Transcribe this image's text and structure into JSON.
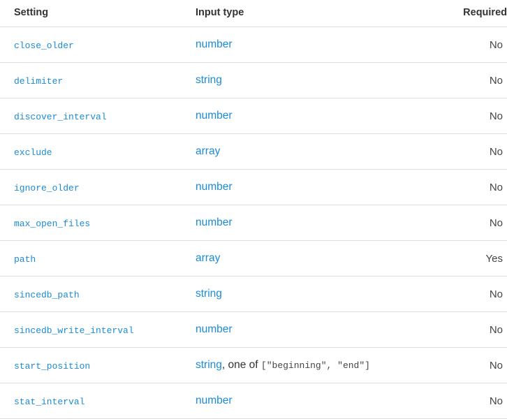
{
  "headers": {
    "setting": "Setting",
    "input_type": "Input type",
    "required": "Required"
  },
  "rows": [
    {
      "setting": "close_older",
      "type_link": "number",
      "type_extra": "",
      "type_code": "",
      "required": "No"
    },
    {
      "setting": "delimiter",
      "type_link": "string",
      "type_extra": "",
      "type_code": "",
      "required": "No"
    },
    {
      "setting": "discover_interval",
      "type_link": "number",
      "type_extra": "",
      "type_code": "",
      "required": "No"
    },
    {
      "setting": "exclude",
      "type_link": "array",
      "type_extra": "",
      "type_code": "",
      "required": "No"
    },
    {
      "setting": "ignore_older",
      "type_link": "number",
      "type_extra": "",
      "type_code": "",
      "required": "No"
    },
    {
      "setting": "max_open_files",
      "type_link": "number",
      "type_extra": "",
      "type_code": "",
      "required": "No"
    },
    {
      "setting": "path",
      "type_link": "array",
      "type_extra": "",
      "type_code": "",
      "required": "Yes"
    },
    {
      "setting": "sincedb_path",
      "type_link": "string",
      "type_extra": "",
      "type_code": "",
      "required": "No"
    },
    {
      "setting": "sincedb_write_interval",
      "type_link": "number",
      "type_extra": "",
      "type_code": "",
      "required": "No"
    },
    {
      "setting": "start_position",
      "type_link": "string",
      "type_extra": ", one of ",
      "type_code": "[\"beginning\", \"end\"]",
      "required": "No"
    },
    {
      "setting": "stat_interval",
      "type_link": "number",
      "type_extra": "",
      "type_code": "",
      "required": "No"
    }
  ]
}
